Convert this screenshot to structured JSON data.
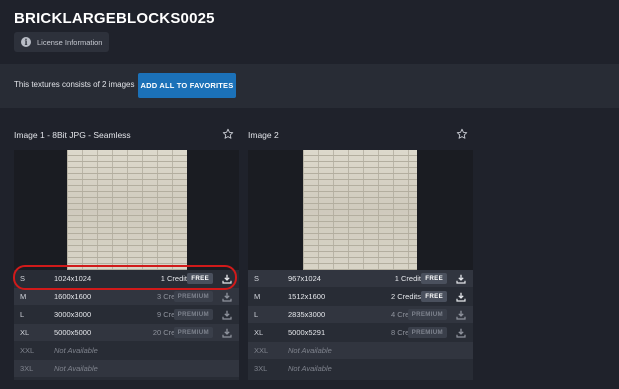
{
  "page": {
    "title": "BRICKLARGEBLOCKS0025",
    "license_label": "License Information"
  },
  "info_panel": {
    "count_text": "This textures consists of 2 images",
    "add_favorites_label": "ADD ALL TO FAVORITES"
  },
  "images": [
    {
      "title": "Image 1 - 8Bit JPG - Seamless",
      "rows": [
        {
          "size": "S",
          "res": "1024x1024",
          "credits": "1 Credit",
          "badge": "FREE"
        },
        {
          "size": "M",
          "res": "1600x1600",
          "credits": "3 Credits",
          "badge": "PREMIUM"
        },
        {
          "size": "L",
          "res": "3000x3000",
          "credits": "9 Credits",
          "badge": "PREMIUM"
        },
        {
          "size": "XL",
          "res": "5000x5000",
          "credits": "20 Credits",
          "badge": "PREMIUM"
        },
        {
          "size": "XXL",
          "res": "Not Available",
          "credits": "",
          "badge": ""
        },
        {
          "size": "3XL",
          "res": "Not Available",
          "credits": "",
          "badge": ""
        }
      ]
    },
    {
      "title": "Image 2",
      "rows": [
        {
          "size": "S",
          "res": "967x1024",
          "credits": "1 Credit",
          "badge": "FREE"
        },
        {
          "size": "M",
          "res": "1512x1600",
          "credits": "2 Credits",
          "badge": "FREE"
        },
        {
          "size": "L",
          "res": "2835x3000",
          "credits": "4 Credits",
          "badge": "PREMIUM"
        },
        {
          "size": "XL",
          "res": "5000x5291",
          "credits": "8 Credits",
          "badge": "PREMIUM"
        },
        {
          "size": "XXL",
          "res": "Not Available",
          "credits": "",
          "badge": ""
        },
        {
          "size": "3XL",
          "res": "Not Available",
          "credits": "",
          "badge": ""
        }
      ]
    }
  ],
  "colors": {
    "background": "#1f222b",
    "panel": "#282c35",
    "accent_button": "#1b71b8",
    "highlight_ring": "#d11a1a"
  }
}
